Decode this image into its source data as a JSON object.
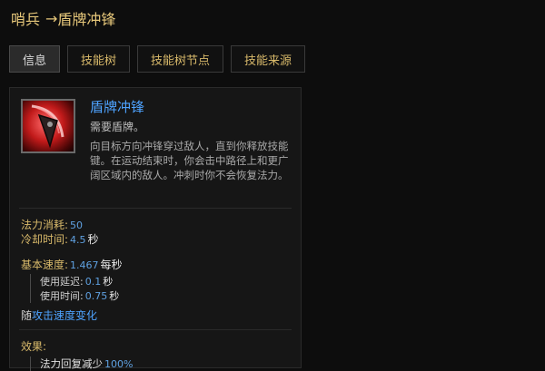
{
  "header": {
    "unit_name": "哨兵",
    "arrow": "→",
    "skill_name": "盾牌冲锋"
  },
  "tabs": [
    {
      "label": "信息",
      "active": true
    },
    {
      "label": "技能树",
      "active": false
    },
    {
      "label": "技能树节点",
      "active": false
    },
    {
      "label": "技能来源",
      "active": false
    }
  ],
  "skill": {
    "icon": "shield-charge-icon",
    "name": "盾牌冲锋",
    "requirement": "需要盾牌。",
    "description": "向目标方向冲锋穿过敌人，直到你释放技能键。在运动结束时，你会击中路径上和更广阔区域内的敌人。冲刺时你不会恢复法力。"
  },
  "stats": {
    "mana_cost": {
      "label": "法力消耗:",
      "value": "50"
    },
    "cooldown": {
      "label": "冷却时间:",
      "value": "4.5",
      "unit": "秒"
    },
    "base_speed": {
      "label": "基本速度:",
      "value": "1.467",
      "unit": "每秒"
    },
    "use_delay": {
      "label": "使用延迟:",
      "value": "0.1",
      "unit": "秒"
    },
    "use_time": {
      "label": "使用时间:",
      "value": "0.75",
      "unit": "秒"
    },
    "speed_note": {
      "prefix": "随",
      "text": "攻击速度变化"
    }
  },
  "effects": {
    "label": "效果:",
    "items": [
      {
        "label": "法力回复减少",
        "value": "100%"
      }
    ]
  },
  "colors": {
    "gold": "#d8b96a",
    "blue": "#4ea3ff",
    "value_blue": "#5fa0e0",
    "background": "#0d0d0d"
  }
}
